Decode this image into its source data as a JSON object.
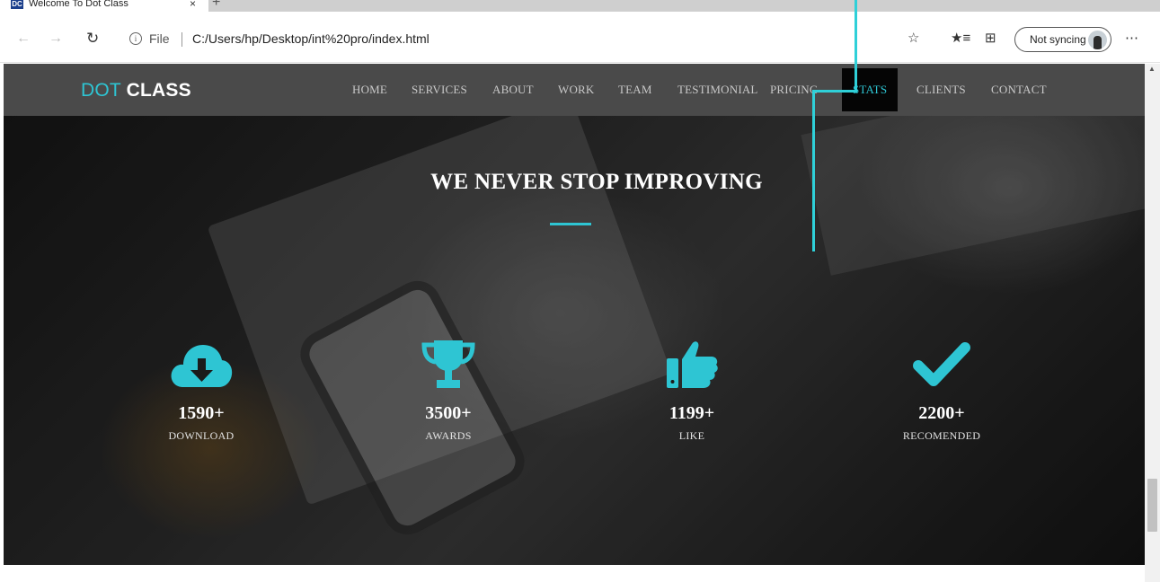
{
  "browser": {
    "tab": {
      "favicon_text": "DC",
      "title": "Welcome To Dot Class",
      "close_glyph": "×",
      "new_tab_glyph": "+"
    },
    "address": {
      "scheme_label": "File",
      "url": "C:/Users/hp/Desktop/int%20pro/index.html",
      "info_icon": "info-icon"
    },
    "sync_label": "Not syncing",
    "toolbar_icons": [
      "back-arrow-icon",
      "forward-arrow-icon",
      "reload-icon",
      "star-icon",
      "favorites-icon",
      "collections-icon",
      "more-icon"
    ]
  },
  "site": {
    "logo": {
      "part1": "DOT",
      "part2": "CLASS"
    },
    "nav": [
      "HOME",
      "SERVICES",
      "ABOUT",
      "WORK",
      "TEAM",
      "TESTIMONIAL",
      "PRICING",
      "STATS",
      "CLIENTS",
      "CONTACT"
    ],
    "active_nav": "STATS",
    "accent_color": "#2ec5d3",
    "nav_bg": "#4a4a4a"
  },
  "hero": {
    "title": "WE NEVER STOP IMPROVING",
    "stats": [
      {
        "icon": "cloud-download-icon",
        "value": "1590+",
        "label": "DOWNLOAD"
      },
      {
        "icon": "trophy-icon",
        "value": "3500+",
        "label": "AWARDS"
      },
      {
        "icon": "thumbs-up-icon",
        "value": "1199+",
        "label": "LIKE"
      },
      {
        "icon": "checkmark-icon",
        "value": "2200+",
        "label": "RECOMENDED"
      }
    ]
  }
}
